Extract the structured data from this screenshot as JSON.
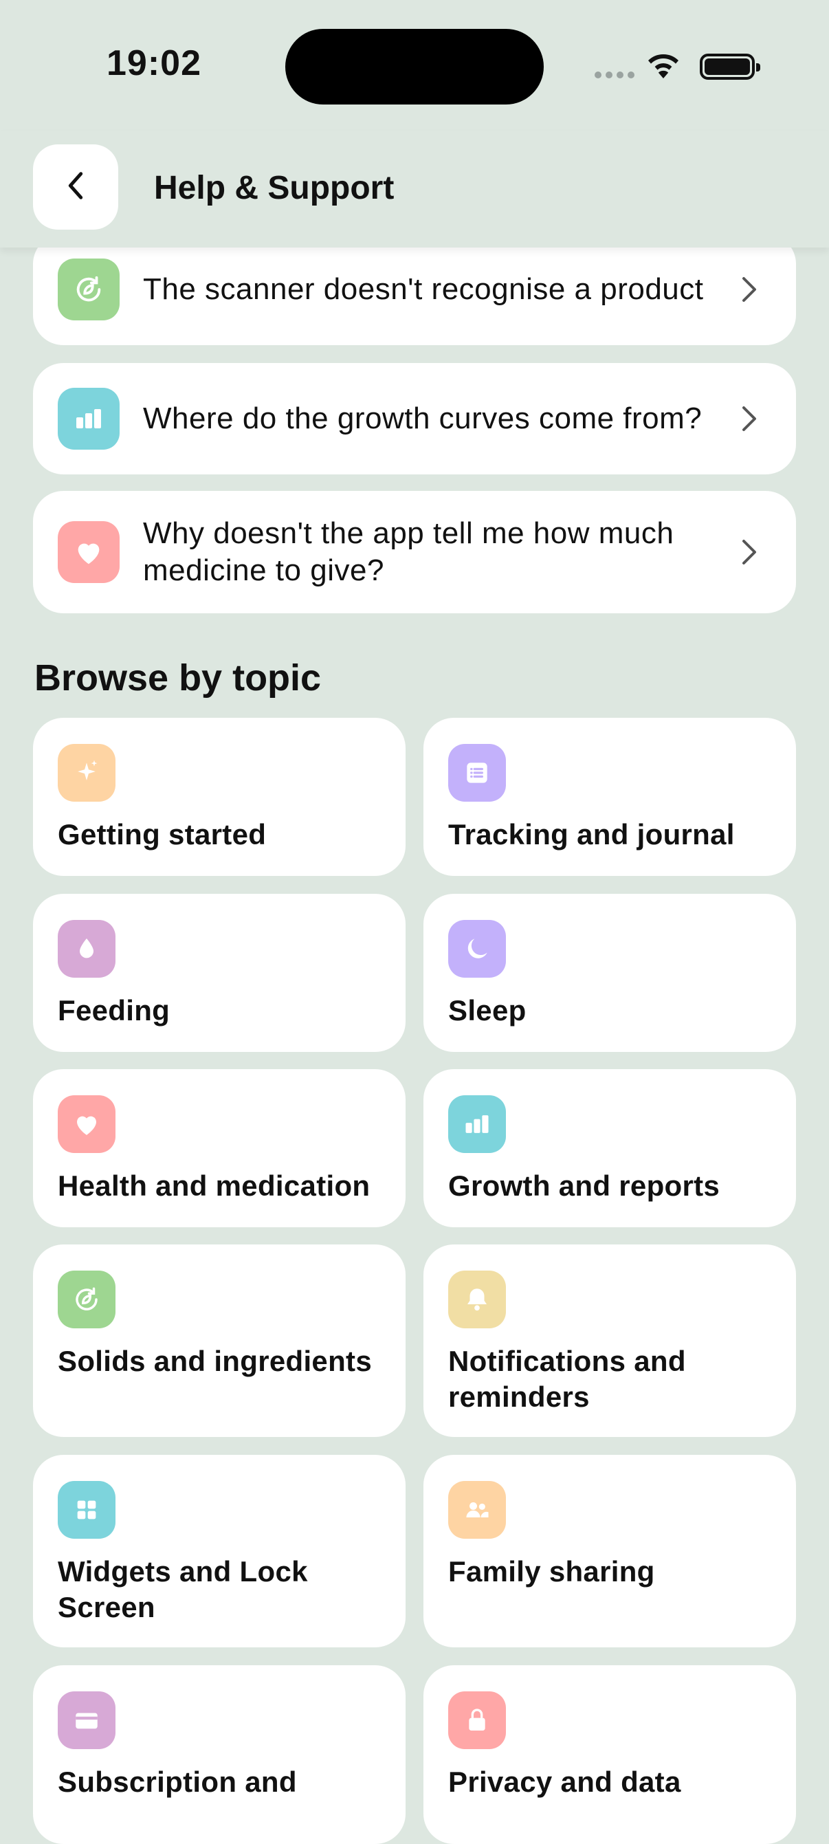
{
  "status": {
    "time": "19:02"
  },
  "header": {
    "title": "Help & Support"
  },
  "faq": [
    {
      "text": "The scanner doesn't recognise a product",
      "icon": "leaf-cycle-icon",
      "color": "#9ed691"
    },
    {
      "text": "Where do the growth curves come from?",
      "icon": "bar-chart-icon",
      "color": "#7dd4dc"
    },
    {
      "text": "Why doesn't the app tell me how much medicine to give?",
      "icon": "heart-icon",
      "color": "#ffa7a7"
    }
  ],
  "browse": {
    "title": "Browse by topic",
    "topics": [
      {
        "label": "Getting started",
        "icon": "sparkle-icon",
        "color": "#fed4a3"
      },
      {
        "label": "Tracking and journal",
        "icon": "list-icon",
        "color": "#c3b1fb"
      },
      {
        "label": "Feeding",
        "icon": "droplet-icon",
        "color": "#d7a9d6"
      },
      {
        "label": "Sleep",
        "icon": "moon-icon",
        "color": "#c3b1fb"
      },
      {
        "label": "Health and medication",
        "icon": "heart-icon",
        "color": "#ffa7a7"
      },
      {
        "label": "Growth and reports",
        "icon": "bar-chart-icon",
        "color": "#7dd4dc"
      },
      {
        "label": "Solids and ingredients",
        "icon": "leaf-cycle-icon",
        "color": "#9ed691"
      },
      {
        "label": "Notifications and reminders",
        "icon": "bell-icon",
        "color": "#f1dea4"
      },
      {
        "label": "Widgets and Lock Screen",
        "icon": "grid-icon",
        "color": "#7dd4dc"
      },
      {
        "label": "Family sharing",
        "icon": "people-icon",
        "color": "#fed4a3"
      },
      {
        "label": "Subscription and",
        "icon": "card-icon",
        "color": "#d7a9d6"
      },
      {
        "label": "Privacy and data",
        "icon": "lock-icon",
        "color": "#ffa7a7"
      }
    ]
  }
}
